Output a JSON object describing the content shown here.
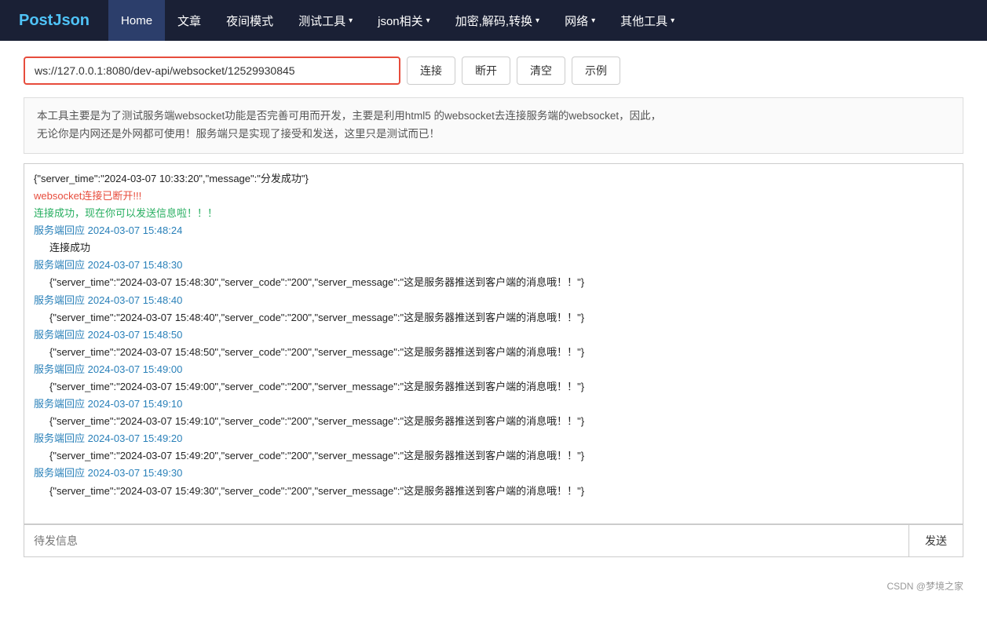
{
  "navbar": {
    "brand": "PostJson",
    "items": [
      {
        "label": "Home",
        "active": true,
        "hasArrow": false
      },
      {
        "label": "文章",
        "active": false,
        "hasArrow": false
      },
      {
        "label": "夜间模式",
        "active": false,
        "hasArrow": false
      },
      {
        "label": "测试工具",
        "active": false,
        "hasArrow": true
      },
      {
        "label": "json相关",
        "active": false,
        "hasArrow": true
      },
      {
        "label": "加密,解码,转换",
        "active": false,
        "hasArrow": true
      },
      {
        "label": "网络",
        "active": false,
        "hasArrow": true
      },
      {
        "label": "其他工具",
        "active": false,
        "hasArrow": true
      }
    ]
  },
  "url_bar": {
    "url_value": "ws://127.0.0.1:8080/dev-api/websocket/12529930845",
    "url_placeholder": "ws://127.0.0.1:8080/dev-api/websocket/12529930845",
    "btn_connect": "连接",
    "btn_disconnect": "断开",
    "btn_clear": "清空",
    "btn_example": "示例"
  },
  "info_box": {
    "line1": "本工具主要是为了测试服务端websocket功能是否完善可用而开发，主要是利用html5 的websocket去连接服务端的websocket，因此，",
    "line2": "无论你是内网还是外网都可使用！服务端只是实现了接受和发送，这里只是测试而已！"
  },
  "log": {
    "entries": [
      {
        "text": "{\"server_time\":\"2024-03-07 10:33:20\",\"message\":\"分发成功\"}",
        "color": "black",
        "indented": false
      },
      {
        "text": "websocket连接已断开!!!",
        "color": "red",
        "indented": false
      },
      {
        "text": "连接成功，现在你可以发送信息啦！！！",
        "color": "green",
        "indented": false
      },
      {
        "text": "服务端回应 2024-03-07 15:48:24",
        "color": "blue",
        "indented": false
      },
      {
        "text": "连接成功",
        "color": "black",
        "indented": true
      },
      {
        "text": "服务端回应 2024-03-07 15:48:30",
        "color": "blue",
        "indented": false
      },
      {
        "text": "{\"server_time\":\"2024-03-07 15:48:30\",\"server_code\":\"200\",\"server_message\":\"这是服务器推送到客户端的消息哦！！\"}",
        "color": "black",
        "indented": true
      },
      {
        "text": "服务端回应 2024-03-07 15:48:40",
        "color": "blue",
        "indented": false
      },
      {
        "text": "{\"server_time\":\"2024-03-07 15:48:40\",\"server_code\":\"200\",\"server_message\":\"这是服务器推送到客户端的消息哦！！\"}",
        "color": "black",
        "indented": true
      },
      {
        "text": "服务端回应 2024-03-07 15:48:50",
        "color": "blue",
        "indented": false
      },
      {
        "text": "{\"server_time\":\"2024-03-07 15:48:50\",\"server_code\":\"200\",\"server_message\":\"这是服务器推送到客户端的消息哦！！\"}",
        "color": "black",
        "indented": true
      },
      {
        "text": "服务端回应 2024-03-07 15:49:00",
        "color": "blue",
        "indented": false
      },
      {
        "text": "{\"server_time\":\"2024-03-07 15:49:00\",\"server_code\":\"200\",\"server_message\":\"这是服务器推送到客户端的消息哦！！\"}",
        "color": "black",
        "indented": true
      },
      {
        "text": "服务端回应 2024-03-07 15:49:10",
        "color": "blue",
        "indented": false
      },
      {
        "text": "{\"server_time\":\"2024-03-07 15:49:10\",\"server_code\":\"200\",\"server_message\":\"这是服务器推送到客户端的消息哦！！\"}",
        "color": "black",
        "indented": true
      },
      {
        "text": "服务端回应 2024-03-07 15:49:20",
        "color": "blue",
        "indented": false
      },
      {
        "text": "{\"server_time\":\"2024-03-07 15:49:20\",\"server_code\":\"200\",\"server_message\":\"这是服务器推送到客户端的消息哦！！\"}",
        "color": "black",
        "indented": true
      },
      {
        "text": "服务端回应 2024-03-07 15:49:30",
        "color": "blue",
        "indented": false
      },
      {
        "text": "{\"server_time\":\"2024-03-07 15:49:30\",\"server_code\":\"200\",\"server_message\":\"这是服务器推送到客户端的消息哦！！\"}",
        "color": "black",
        "indented": true
      }
    ]
  },
  "send_bar": {
    "placeholder": "待发信息",
    "send_label": "发送"
  },
  "footer": {
    "text": "CSDN @梦境之家"
  }
}
